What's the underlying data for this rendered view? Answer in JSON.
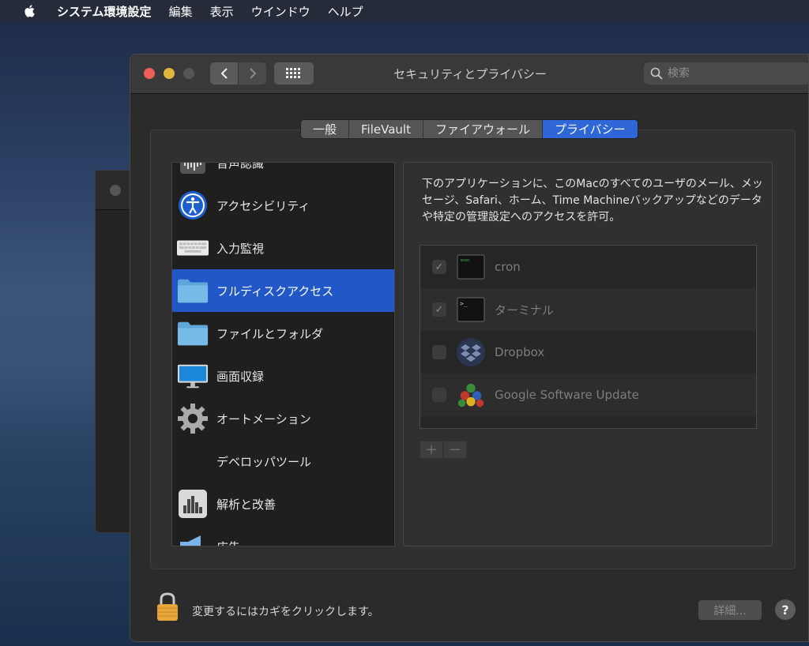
{
  "menubar": {
    "app_name": "システム環境設定",
    "items": [
      "編集",
      "表示",
      "ウインドウ",
      "ヘルプ"
    ]
  },
  "window": {
    "title": "セキュリティとプライバシー",
    "search_placeholder": "検索"
  },
  "tabs": [
    {
      "label": "一般",
      "active": false
    },
    {
      "label": "FileVault",
      "active": false
    },
    {
      "label": "ファイアウォール",
      "active": false
    },
    {
      "label": "プライバシー",
      "active": true
    }
  ],
  "sidebar": {
    "items": [
      {
        "label": "音声認識",
        "icon": "waveform-icon",
        "selected": false
      },
      {
        "label": "アクセシビリティ",
        "icon": "accessibility-icon",
        "selected": false
      },
      {
        "label": "入力監視",
        "icon": "keyboard-icon",
        "selected": false
      },
      {
        "label": "フルディスクアクセス",
        "icon": "folder-icon",
        "selected": true
      },
      {
        "label": "ファイルとフォルダ",
        "icon": "folder-icon",
        "selected": false
      },
      {
        "label": "画面収録",
        "icon": "display-icon",
        "selected": false
      },
      {
        "label": "オートメーション",
        "icon": "gear-icon",
        "selected": false
      },
      {
        "label": "デベロッパツール",
        "icon": "",
        "selected": false
      },
      {
        "label": "解析と改善",
        "icon": "chart-icon",
        "selected": false
      },
      {
        "label": "広告",
        "icon": "megaphone-icon",
        "selected": false
      }
    ]
  },
  "content": {
    "description": "下のアプリケーションに、このMacのすべてのユーザのメール、メッセージ、Safari、ホーム、Time Machineバックアップなどのデータや特定の管理設定へのアクセスを許可。",
    "apps": [
      {
        "name": "cron",
        "checked": true,
        "icon": "terminal-exec-icon"
      },
      {
        "name": "ターミナル",
        "checked": true,
        "icon": "terminal-icon"
      },
      {
        "name": "Dropbox",
        "checked": false,
        "icon": "dropbox-icon"
      },
      {
        "name": "Google Software Update",
        "checked": false,
        "icon": "google-update-icon"
      }
    ],
    "add_label": "+",
    "remove_label": "−"
  },
  "footer": {
    "lock_text": "変更するにはカギをクリックします。",
    "details_label": "詳細...",
    "help_label": "?"
  }
}
